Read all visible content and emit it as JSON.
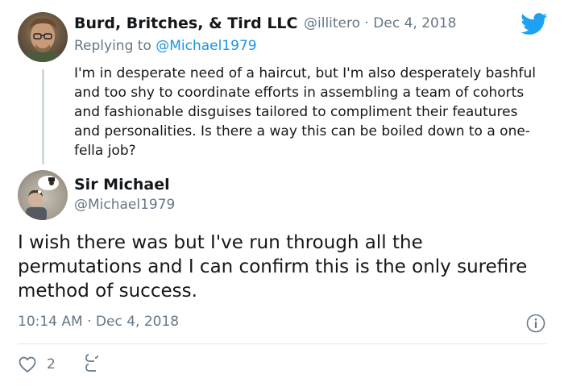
{
  "reply_tweet": {
    "name": "Burd, Britches, & Tird LLC",
    "handle": "@illitero",
    "separator": "·",
    "date": "Dec 4, 2018",
    "replying_prefix": "Replying to",
    "replying_to": "@Michael1979",
    "text": "I'm in desperate need of a haircut, but I'm also desperately bashful and too shy to coordinate efforts in assembling a team of cohorts and fashionable disguises tailored to compliment their feautures and personalities. Is there a way this can be boiled down to a one-fella job?"
  },
  "main_tweet": {
    "name": "Sir Michael",
    "handle": "@Michael1979",
    "text": "I wish there was but I've run through all the permutations and I can confirm this is the only surefire method of success.",
    "timestamp": "10:14 AM · Dec 4, 2018",
    "like_count": "2"
  },
  "icons": {
    "brand": "twitter-bird-icon",
    "info": "info-icon",
    "like": "heart-icon",
    "reply": "reply-icon"
  },
  "colors": {
    "brand_blue": "#1da1f2",
    "link_blue": "#1b95e0",
    "secondary_text": "#657786",
    "primary_text": "#14171a"
  }
}
